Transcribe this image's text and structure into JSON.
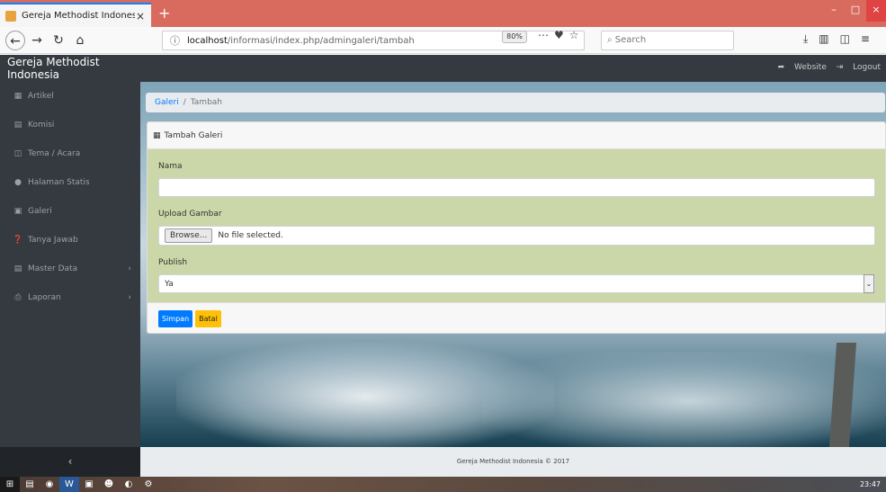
{
  "browser": {
    "tab_title": "Gereja Methodist Indonesia",
    "tab_close": "×",
    "new_tab": "+",
    "url_host": "localhost",
    "url_path": "/informasi/index.php/admingaleri/tambah",
    "zoom": "80%",
    "search_placeholder": "Search",
    "window_controls": {
      "minimize": "–",
      "maximize": "□",
      "close": "×"
    }
  },
  "header": {
    "brand": "Gereja Methodist Indonesia",
    "website_link": "Website",
    "logout_link": "Logout"
  },
  "sidebar": {
    "items": [
      {
        "label": "Artikel",
        "icon": "newspaper-icon",
        "glyph": "▦"
      },
      {
        "label": "Komisi",
        "icon": "id-card-icon",
        "glyph": "▤"
      },
      {
        "label": "Tema / Acara",
        "icon": "calendar-icon",
        "glyph": "◫"
      },
      {
        "label": "Halaman Statis",
        "icon": "info-icon",
        "glyph": "●"
      },
      {
        "label": "Galeri",
        "icon": "image-icon",
        "glyph": "▣"
      },
      {
        "label": "Tanya Jawab",
        "icon": "question-icon",
        "glyph": "❓"
      },
      {
        "label": "Master Data",
        "icon": "database-icon",
        "glyph": "▤",
        "chevron": "›"
      },
      {
        "label": "Laporan",
        "icon": "print-icon",
        "glyph": "⎙",
        "chevron": "›"
      }
    ],
    "toggle": "‹"
  },
  "breadcrumb": {
    "link": "Galeri",
    "separator": "/",
    "current": "Tambah"
  },
  "form": {
    "card_title": "Tambah Galeri",
    "nama_label": "Nama",
    "nama_value": "",
    "upload_label": "Upload Gambar",
    "browse_label": "Browse...",
    "file_status": "No file selected.",
    "publish_label": "Publish",
    "publish_value": "Ya",
    "save_label": "Simpan",
    "cancel_label": "Batal"
  },
  "footer": {
    "text": "Gereja Methodist Indonesia © 2017"
  },
  "taskbar": {
    "clock": "23:47"
  },
  "colors": {
    "header_bg": "#343a40",
    "primary": "#007bff",
    "warning": "#ffc107",
    "form_bg": "#cbd7a9"
  }
}
